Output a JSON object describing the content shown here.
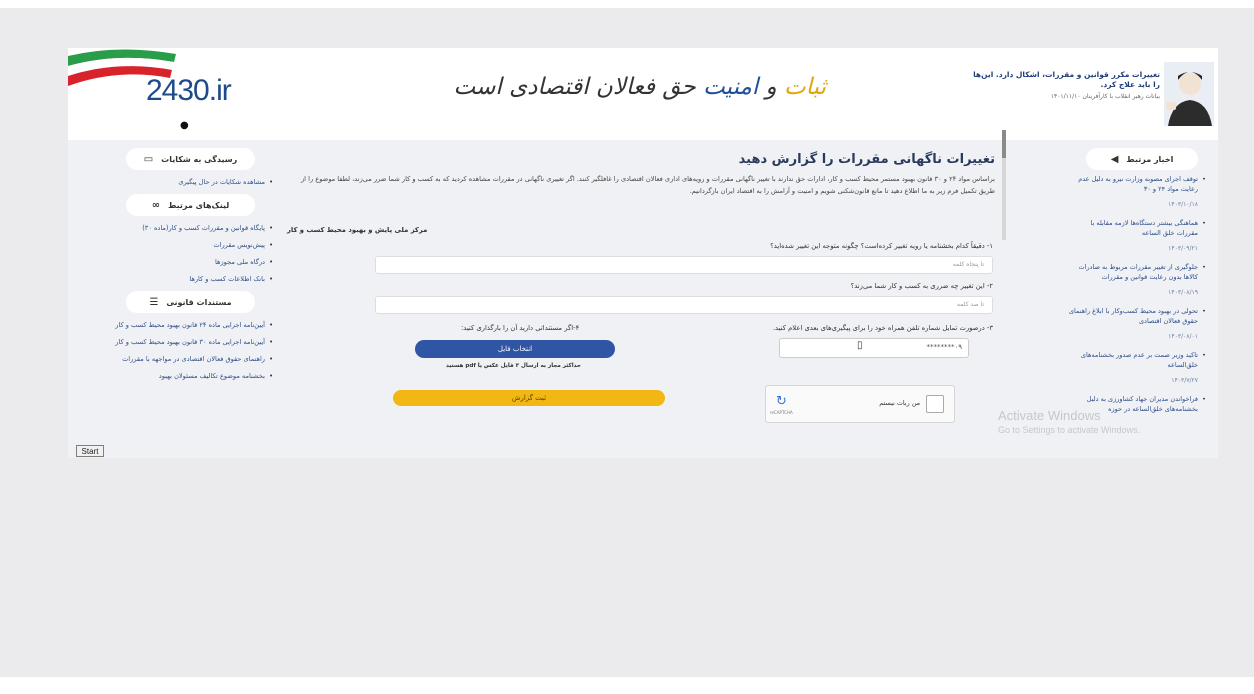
{
  "header": {
    "domain": "2430.ir",
    "slogan_part1": "ثبات",
    "slogan_part2": " و ",
    "slogan_part3": "امنیت",
    "slogan_part4": " حق فعالان اقتصادی است",
    "quote": "تغییرات مکرر قوانین و مقررات، اشکال دارد. این‌ها را باید علاج کرد.",
    "quote_source": "بیانات رهبر انقلاب با کارآفرینان ۱۴۰۱/۱۱/۱۰"
  },
  "sidebar_left": {
    "complaints_title": "رسیدگی به شکایات",
    "complaints_items": [
      "مشاهده شکایات در حال پیگیری"
    ],
    "links_title": "لینک‌های مرتبط",
    "links_items": [
      "پایگاه قوانین و مقررات کسب و کار(ماده ۳۰)",
      "پیش‌نویس مقررات",
      "درگاه ملی مجوزها",
      "بانک اطلاعات کسب و کارها"
    ],
    "docs_title": "مستندات قانونی",
    "docs_items": [
      "آیین‌نامه اجرایی ماده ۲۴ قانون بهبود محیط کسب و کار",
      "آیین‌نامه اجرایی ماده ۳۰ قانون بهبود محیط کسب و کار",
      "راهنمای حقوق فعالان اقتصادی در مواجهه با مقررات",
      "بخشنامه موضوع تکالیف مسئولان بهبود"
    ]
  },
  "sidebar_right": {
    "title": "اخبار مرتبط",
    "news": [
      {
        "text": "توقف اجرای مصوبه وزارت نیرو به دلیل عدم رعایت مواد ۲۴ و ۳۰",
        "date": "۱۴۰۳/۱۰/۱۸"
      },
      {
        "text": "هماهنگی بیشتر دستگاه‌ها لازمه مقابله با مقررات خلق الساعه",
        "date": "۱۴۰۳/۰۹/۲۱"
      },
      {
        "text": "جلوگیری از تغییر مقررات مربوط به صادرات کالاها بدون رعایت قوانین و مقررات",
        "date": "۱۴۰۳/۰۸/۱۹"
      },
      {
        "text": "تحولی در بهبود محیط کسب‌وکار با ابلاغ راهنمای حقوق فعالان اقتصادی",
        "date": "۱۴۰۳/۰۸/۰۱"
      },
      {
        "text": "تاکید وزیر صمت بر عدم صدور بخشنامه‌های خلق‌الساعه",
        "date": "۱۴۰۳/۷/۲۷"
      },
      {
        "text": "فراخواندن مدیران جهاد کشاورزی به دلیل بخشنامه‌های خلق‌الساعه در حوزه",
        "date": ""
      }
    ]
  },
  "main": {
    "title": "تغییرات ناگهانی مقررات را گزارش دهید",
    "intro": "براساس مواد ۲۴ و ۳۰ قانون بهبود مستمر محیط کسب و کار، ادارات حق ندارند با تغییر ناگهانی مقررات و رویه‌های اداری فعالان اقتصادی را غافلگیر کنند. اگر تغییری ناگهانی در مقررات مشاهده کردید که به کسب و کار شما ضرر می‌زند، لطفا موضوع را از طریق تکمیل فرم زیر به ما اطلاع دهید تا مانع قانون‌شکنی شویم و امنیت و آرامش را به اقتصاد ایران بازگردانیم.",
    "center_name": "مرکز ملی پایش و بهبود محیط کسب و کار",
    "q1": "۱- دقیقاً کدام بخشنامه یا رویه تغییر کرده‌است؟ چگونه متوجه این تغییر شده‌اید؟",
    "q1_placeholder": "تا پنجاه کلمه",
    "q2": "۲- این تغییر چه ضرری به کسب و کار شما می‌زند؟",
    "q2_placeholder": "تا صد کلمه",
    "q3": "۳- درصورت تمایل شماره تلفن همراه خود را برای پیگیری‌های بعدی اعلام کنید.",
    "phone_placeholder": "۰۹********",
    "q4": "۴-اگر مستنداتی دارید آن را بارگذاری کنید:",
    "file_button": "انتخاب فایل",
    "file_note": "حداکثر مجاز به ارسال ۳ فایل عکس یا pdf هستید",
    "submit_button": "ثبت گزارش",
    "captcha_label": "من ربات نیستم",
    "captcha_brand": "reCAPTCHA"
  },
  "watermark": {
    "line1": "Activate Windows",
    "line2": "Go to Settings to activate Windows."
  },
  "taskbar": {
    "start_label": "Start"
  }
}
